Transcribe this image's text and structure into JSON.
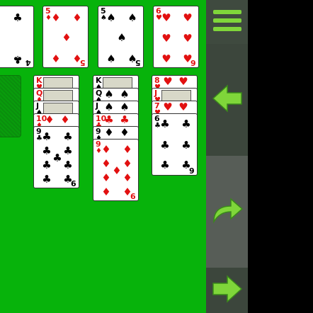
{
  "foundations": [
    {
      "rank": "4",
      "suit": "clubs",
      "symbol": "♣",
      "color": "black"
    },
    {
      "rank": "5",
      "suit": "diamonds",
      "symbol": "♦",
      "color": "red"
    },
    {
      "rank": "5",
      "suit": "spades",
      "symbol": "♠",
      "color": "black"
    },
    {
      "rank": "6",
      "suit": "hearts",
      "symbol": "♥",
      "color": "red"
    }
  ],
  "tableau": [
    [
      {
        "rank": "K",
        "symbol": "♥",
        "color": "red"
      },
      {
        "rank": "Q",
        "symbol": "♦",
        "color": "red"
      },
      {
        "rank": "J",
        "symbol": "♠",
        "color": "black"
      },
      {
        "rank": "10",
        "symbol": "♦",
        "color": "red"
      },
      {
        "rank": "9",
        "symbol": "♣",
        "color": "black"
      }
    ],
    [
      {
        "rank": "K",
        "symbol": "♠",
        "color": "black"
      },
      {
        "rank": "Q",
        "symbol": "♠",
        "color": "black"
      },
      {
        "rank": "J",
        "symbol": "♠",
        "color": "black"
      },
      {
        "rank": "10",
        "symbol": "♣",
        "color": "black"
      },
      {
        "rank": "9",
        "symbol": "♦",
        "color": "red"
      }
    ],
    [
      {
        "rank": "8",
        "symbol": "♥",
        "color": "red"
      },
      {
        "rank": "J",
        "symbol": "♥",
        "color": "red"
      },
      {
        "rank": "7",
        "symbol": "♥",
        "color": "red"
      },
      {
        "rank": "6",
        "symbol": "♣",
        "color": "black"
      }
    ]
  ],
  "sidebar": {
    "menu_icon": "hamburger-icon",
    "undo_icon": "back-arrow-icon",
    "redo_icon": "curved-arrow-icon",
    "next_icon": "forward-arrow-icon"
  },
  "colors": {
    "felt": "#07b30b",
    "sidebar": "#4a4e4a",
    "accent": "#7fd63a"
  }
}
